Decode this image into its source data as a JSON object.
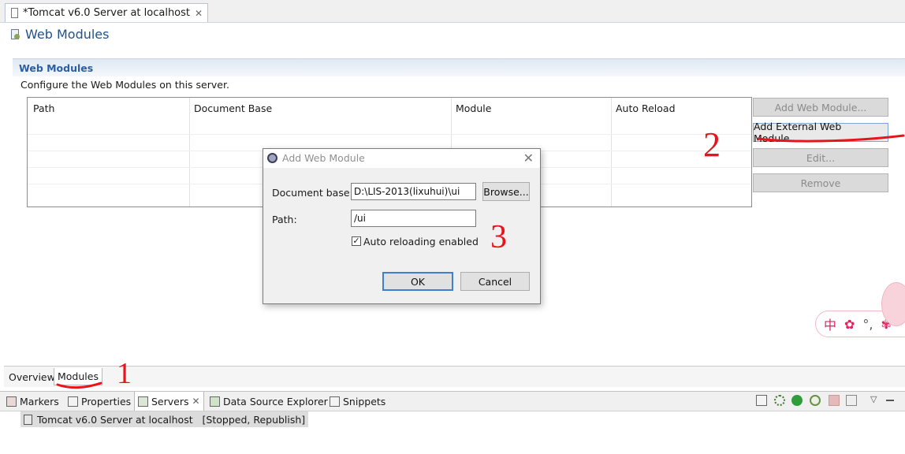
{
  "editor": {
    "tab_title": "*Tomcat v6.0 Server at localhost",
    "page_title": "Web Modules"
  },
  "section": {
    "title": "Web Modules",
    "description": "Configure the Web Modules on this server.",
    "columns": [
      "Path",
      "Document Base",
      "Module",
      "Auto Reload"
    ],
    "rows": []
  },
  "buttons": {
    "add_web_module": "Add Web Module...",
    "add_external_web_module": "Add External Web Module...",
    "edit": "Edit...",
    "remove": "Remove"
  },
  "dialog": {
    "title": "Add Web Module",
    "document_base_label": "Document base:",
    "document_base_value": "D:\\LIS-2013(lixuhui)\\ui",
    "browse_label": "Browse...",
    "path_label": "Path:",
    "path_value": "/ui",
    "auto_reload_label": "Auto reloading enabled",
    "auto_reload_checked": true,
    "ok_label": "OK",
    "cancel_label": "Cancel"
  },
  "editor_tabs": [
    "Overview",
    "Modules"
  ],
  "views": {
    "tabs": [
      "Markers",
      "Properties",
      "Servers",
      "Data Source Explorer",
      "Snippets"
    ],
    "server_entry": "Tomcat v6.0 Server at localhost   [Stopped, Republish]"
  },
  "annotations": [
    "1",
    "2",
    "3"
  ],
  "ime": {
    "label": "中"
  },
  "colors": {
    "annotation_red": "#e8141c",
    "header_blue": "#22528a"
  }
}
